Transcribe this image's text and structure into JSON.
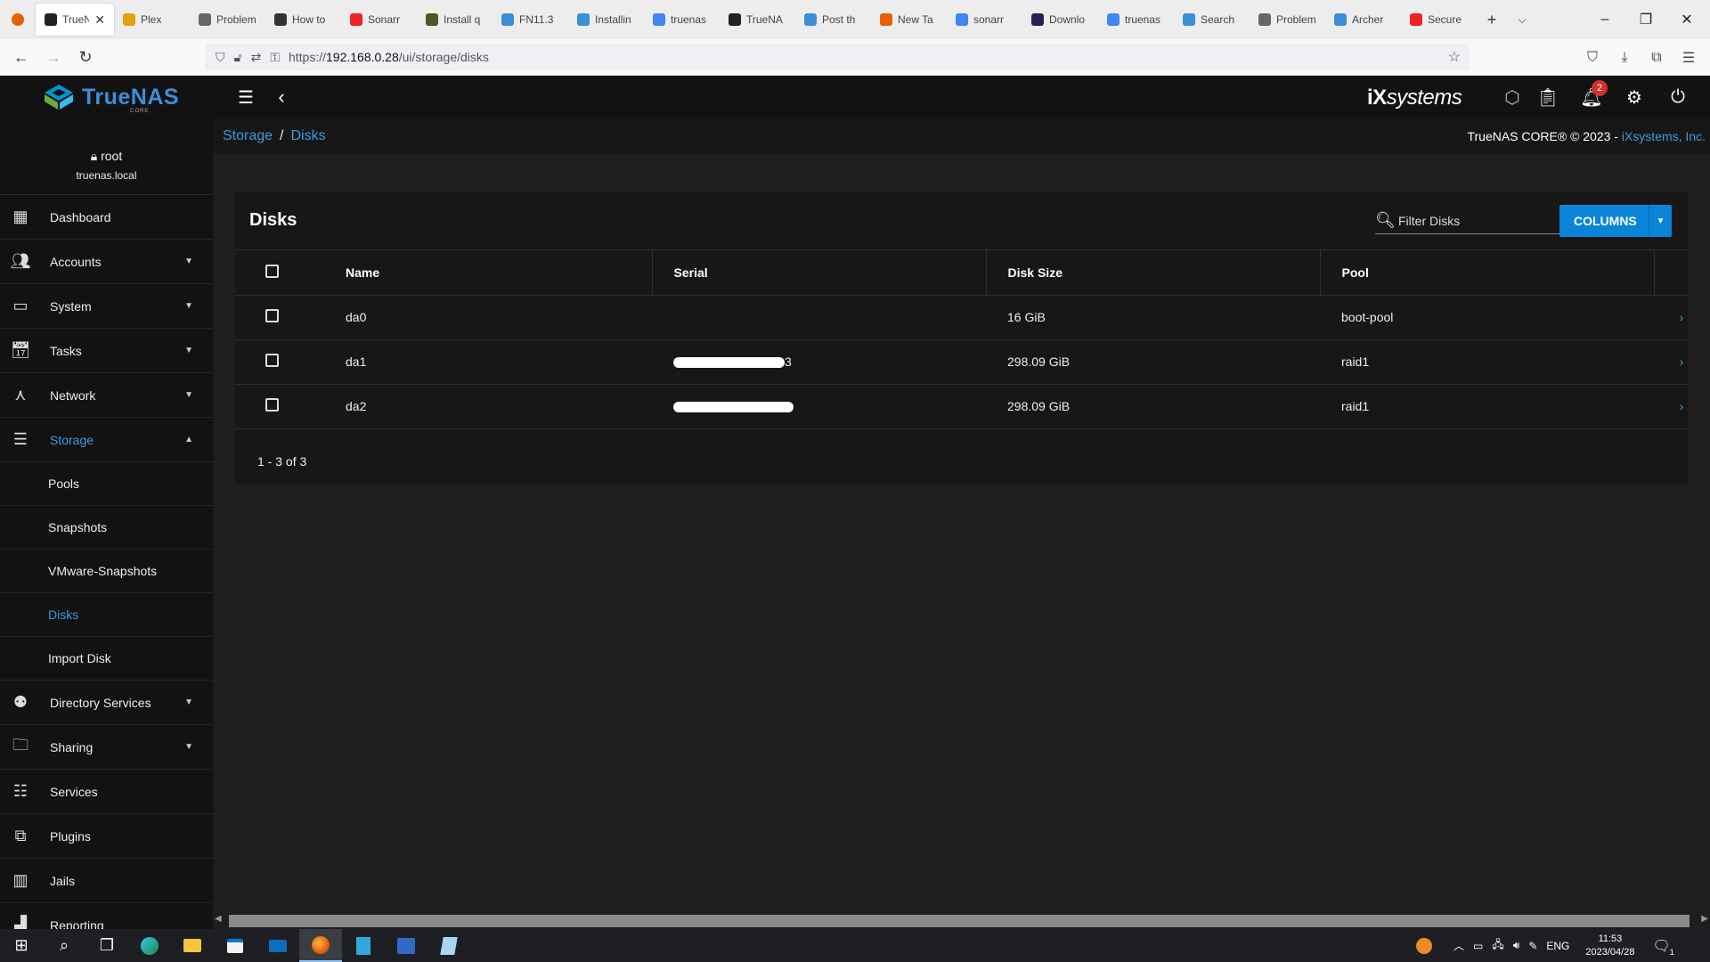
{
  "browser": {
    "tabs": [
      {
        "label": "TrueN",
        "color": "#222",
        "active": true
      },
      {
        "label": "Plex",
        "color": "#e5a00d"
      },
      {
        "label": "Problem",
        "color": "#666"
      },
      {
        "label": "How to",
        "color": "#333"
      },
      {
        "label": "Sonarr",
        "color": "#e22"
      },
      {
        "label": "Install q",
        "color": "#552"
      },
      {
        "label": "FN11.3",
        "color": "#3a8fd6"
      },
      {
        "label": "Installin",
        "color": "#3a8fd6"
      },
      {
        "label": "truenas",
        "color": "#4285f4"
      },
      {
        "label": "TrueNA",
        "color": "#222"
      },
      {
        "label": "Post th",
        "color": "#3a8fd6"
      },
      {
        "label": "New Ta",
        "color": "#e66000"
      },
      {
        "label": "sonarr",
        "color": "#4285f4"
      },
      {
        "label": "Downlo",
        "color": "#225"
      },
      {
        "label": "truenas",
        "color": "#4285f4"
      },
      {
        "label": "Search",
        "color": "#3a8fd6"
      },
      {
        "label": "Problem",
        "color": "#666"
      },
      {
        "label": "Archer",
        "color": "#3a8fd6"
      },
      {
        "label": "Secure",
        "color": "#e22"
      }
    ],
    "url": "https://192.168.0.28/ui/storage/disks",
    "url_prefix": "https://",
    "url_host": "192.168.0.28",
    "url_path": "/ui/storage/disks"
  },
  "app": {
    "logo_text": "TrueNAS",
    "logo_sub": "CORE",
    "vendor_logo": "systems",
    "notifications_count": "2"
  },
  "sidebar": {
    "user": "root",
    "host": "truenas.local",
    "items": [
      {
        "label": "Dashboard",
        "icon": "dashboard-icon"
      },
      {
        "label": "Accounts",
        "icon": "accounts-icon"
      },
      {
        "label": "System",
        "icon": "system-icon"
      },
      {
        "label": "Tasks",
        "icon": "tasks-icon"
      },
      {
        "label": "Network",
        "icon": "network-icon"
      },
      {
        "label": "Storage",
        "icon": "storage-icon"
      }
    ],
    "storage_sub": [
      "Pools",
      "Snapshots",
      "VMware-Snapshots",
      "Disks",
      "Import Disk"
    ],
    "items2": [
      {
        "label": "Directory Services",
        "icon": "directory-services-icon"
      },
      {
        "label": "Sharing",
        "icon": "sharing-icon"
      },
      {
        "label": "Services",
        "icon": "services-icon"
      },
      {
        "label": "Plugins",
        "icon": "plugins-icon"
      },
      {
        "label": "Jails",
        "icon": "jails-icon"
      },
      {
        "label": "Reporting",
        "icon": "reporting-icon"
      }
    ]
  },
  "breadcrumb": {
    "parent": "Storage",
    "sep": "/",
    "current": "Disks"
  },
  "copyright": {
    "text": "TrueNAS CORE® © 2023 - ",
    "link": "iXsystems, Inc."
  },
  "disks": {
    "title": "Disks",
    "filter_placeholder": "Filter Disks",
    "columns_button": "COLUMNS",
    "headers": [
      "Name",
      "Serial",
      "Disk Size",
      "Pool"
    ],
    "rows": [
      {
        "name": "da0",
        "serial": "",
        "size": "16 GiB",
        "pool": "boot-pool"
      },
      {
        "name": "da1",
        "serial": "3",
        "size": "298.09 GiB",
        "pool": "raid1"
      },
      {
        "name": "da2",
        "serial": "",
        "size": "298.09 GiB",
        "pool": "raid1"
      }
    ],
    "footer": "1 - 3 of 3"
  },
  "taskbar": {
    "lang": "ENG",
    "time": "11:53",
    "date": "2023/04/28",
    "notif_count": "1"
  }
}
